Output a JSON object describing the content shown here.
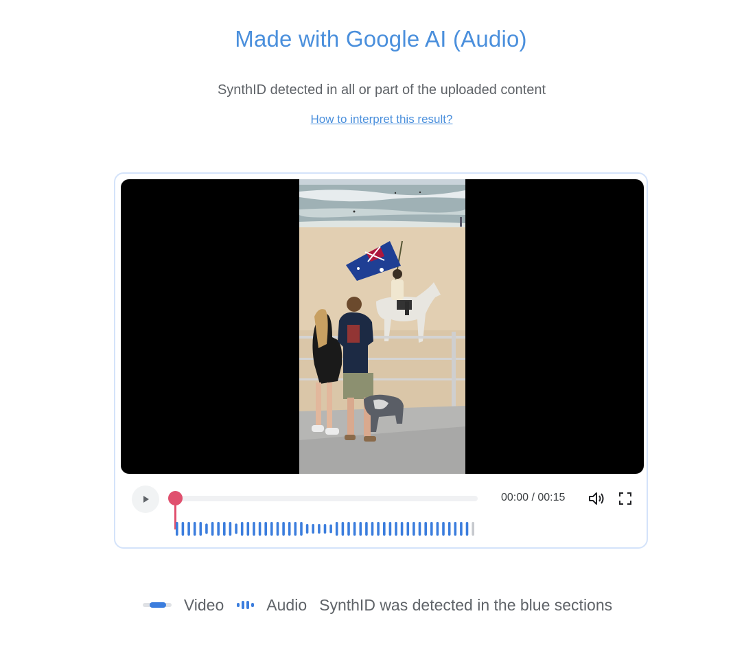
{
  "header": {
    "title": "Made with Google AI (Audio)",
    "subtitle": "SynthID detected in all or part of the uploaded content",
    "help_link": "How to interpret this result?"
  },
  "player": {
    "time_display": "00:00 / 00:15",
    "progress": 0,
    "play_icon": "play-icon",
    "volume_icon": "volume-icon",
    "fullscreen_icon": "fullscreen-icon"
  },
  "legend": {
    "video_label": "Video",
    "audio_label": "Audio",
    "note": "SynthID was detected in the blue sections"
  },
  "colors": {
    "accent": "#4a8fdc",
    "detected": "#3b7ddd",
    "scrubber": "#e0506e"
  }
}
